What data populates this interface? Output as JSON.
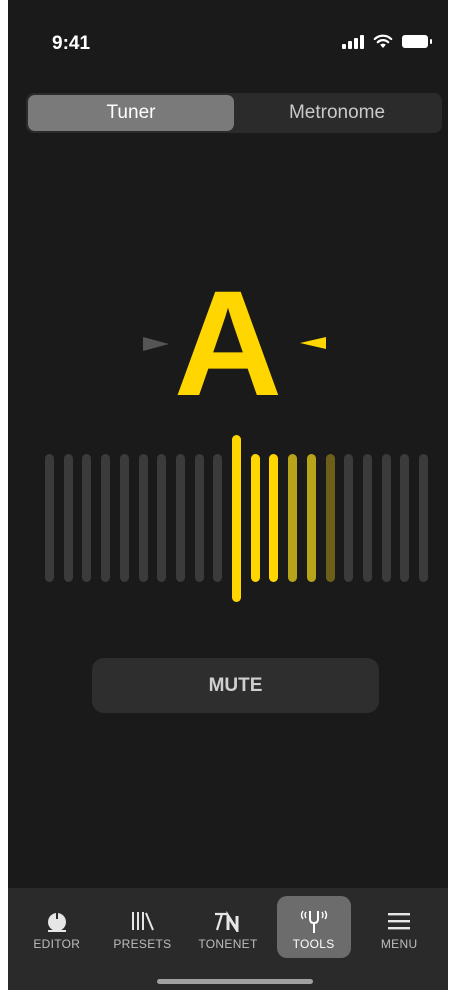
{
  "status_bar": {
    "time": "9:41"
  },
  "segmented": {
    "tabs": [
      {
        "label": "Tuner",
        "active": true
      },
      {
        "label": "Metronome",
        "active": false
      }
    ]
  },
  "tuner": {
    "note": "A",
    "active_color": "#ffd600",
    "inactive_color": "#3b3b3b",
    "highlight_ticks": [
      {
        "index": 10,
        "intensity": 1.0
      },
      {
        "index": 11,
        "intensity": 1.0
      },
      {
        "index": 12,
        "intensity": 1.0
      },
      {
        "index": 13,
        "intensity": 0.7
      },
      {
        "index": 14,
        "intensity": 0.7
      },
      {
        "index": 15,
        "intensity": 0.4
      }
    ],
    "tick_count": 21,
    "center_index": 10
  },
  "mute_button": {
    "label": "MUTE"
  },
  "tab_bar": {
    "items": [
      {
        "label": "EDITOR",
        "icon": "knob-icon",
        "active": false
      },
      {
        "label": "PRESETS",
        "icon": "library-icon",
        "active": false
      },
      {
        "label": "TONENET",
        "icon": "tonenet-icon",
        "active": false
      },
      {
        "label": "TOOLS",
        "icon": "tuning-fork-icon",
        "active": true
      },
      {
        "label": "MENU",
        "icon": "hamburger-icon",
        "active": false
      }
    ]
  }
}
